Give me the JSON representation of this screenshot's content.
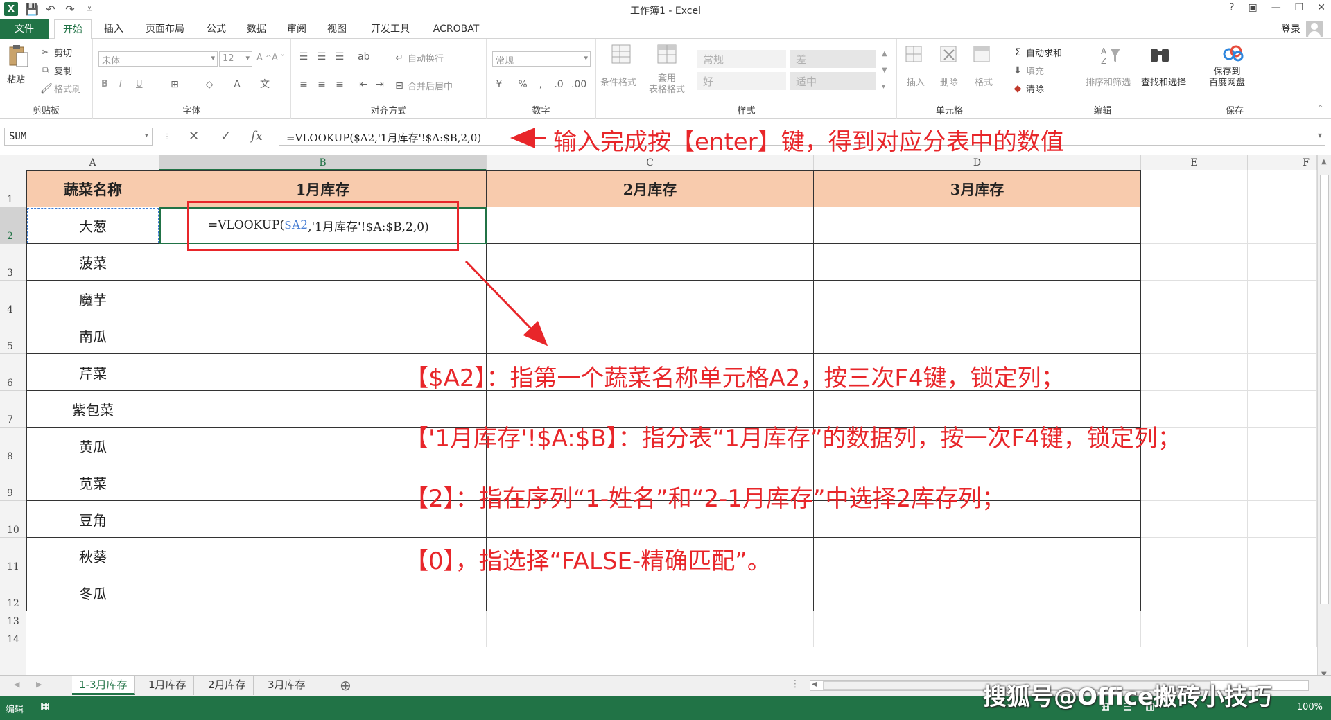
{
  "window": {
    "title": "工作簿1 - Excel",
    "help": "?",
    "controls": [
      "▣",
      "—",
      "❐",
      "✕"
    ]
  },
  "menu": {
    "file": "文件",
    "tabs": [
      "开始",
      "插入",
      "页面布局",
      "公式",
      "数据",
      "审阅",
      "视图",
      "开发工具",
      "ACROBAT"
    ],
    "login": "登录"
  },
  "ribbon": {
    "clipboard": {
      "label": "剪贴板",
      "paste": "粘贴",
      "cut": "剪切",
      "copy": "复制",
      "format_painter": "格式刷"
    },
    "font": {
      "label": "字体",
      "name": "宋体",
      "size": "12",
      "bold": "B",
      "italic": "I",
      "underline": "U"
    },
    "alignment": {
      "label": "对齐方式",
      "wrap": "自动换行",
      "merge": "合并后居中"
    },
    "number": {
      "label": "数字",
      "format": "常规"
    },
    "styles": {
      "label": "样式",
      "conditional": "条件格式",
      "table": "套用\n表格格式",
      "normal": "常规",
      "bad": "差",
      "good": "好",
      "neutral": "适中"
    },
    "cells": {
      "label": "单元格",
      "insert": "插入",
      "delete": "删除",
      "format": "格式"
    },
    "editing": {
      "label": "编辑",
      "autosum": "自动求和",
      "fill": "填充",
      "clear": "清除",
      "sort": "排序和筛选",
      "find": "查找和选择"
    },
    "save": {
      "label": "保存",
      "button": "保存到\n百度网盘"
    }
  },
  "formula_bar": {
    "name_box": "SUM",
    "cancel": "✕",
    "confirm": "✓",
    "fx": "fx",
    "formula": "=VLOOKUP($A2,'1月库存'!$A:$B,2,0)"
  },
  "columns": [
    "A",
    "B",
    "C",
    "D",
    "E",
    "F"
  ],
  "rows": [
    "1",
    "2",
    "3",
    "4",
    "5",
    "6",
    "7",
    "8",
    "9",
    "10",
    "11",
    "12",
    "13",
    "14"
  ],
  "table": {
    "headers": [
      "蔬菜名称",
      "1月库存",
      "2月库存",
      "3月库存"
    ],
    "vegetables": [
      "大葱",
      "菠菜",
      "魔芋",
      "南瓜",
      "芹菜",
      "紫包菜",
      "黄瓜",
      "苋菜",
      "豆角",
      "秋葵",
      "冬瓜"
    ],
    "edit_cell": {
      "prefix": "=VLOOKUP(",
      "ref": "$A2",
      "suffix": ",'1月库存'!$A:$B,2,0)"
    }
  },
  "sheets": [
    "1-3月库存",
    "1月库存",
    "2月库存",
    "3月库存"
  ],
  "status": {
    "mode": "编辑",
    "zoom": "100%"
  },
  "annotations": {
    "top": "输入完成按【enter】键，得到对应分表中的数值",
    "line1": "【$A2】：指第一个蔬菜名称单元格A2，按三次F4键，锁定列；",
    "line2": "【'1月库存'!$A:$B】：指分表“1月库存”的数据列，按一次F4键，锁定列；",
    "line3": "【2】：指在序列“1-姓名”和“2-1月库存”中选择2库存列；",
    "line4": "【0】，指选择“FALSE-精确匹配”。"
  },
  "watermark": "搜狐号@Office搬砖小技巧",
  "colors": {
    "excel_green": "#217346",
    "header_fill": "#f8cbad",
    "annotation_red": "#e8262a"
  }
}
